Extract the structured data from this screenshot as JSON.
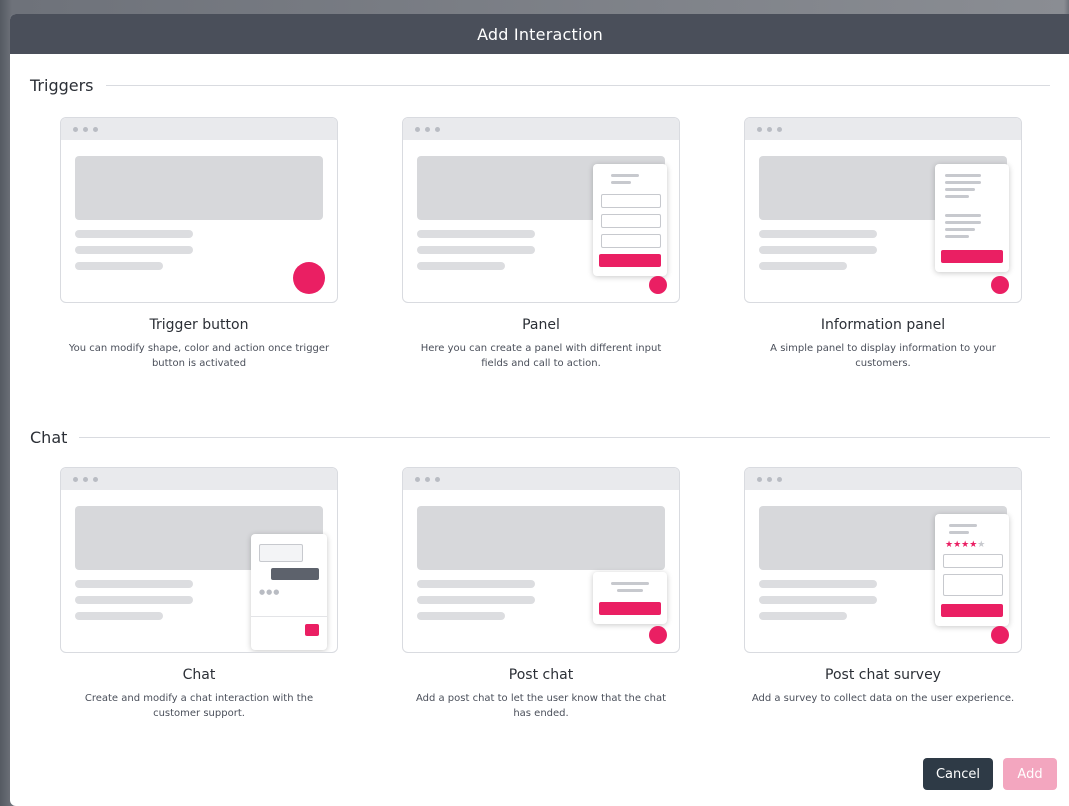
{
  "modal": {
    "title": "Add Interaction"
  },
  "sections": {
    "triggers": {
      "title": "Triggers"
    },
    "chat": {
      "title": "Chat"
    }
  },
  "cards": {
    "trigger_button": {
      "title": "Trigger button",
      "description": "You can modify shape, color and action once trigger button is activated"
    },
    "panel": {
      "title": "Panel",
      "description": "Here you can create a panel with different input fields and call to action."
    },
    "information_panel": {
      "title": "Information panel",
      "description": "A simple panel to display information to your customers."
    },
    "chat": {
      "title": "Chat",
      "description": "Create and modify a chat interaction with the customer support."
    },
    "post_chat": {
      "title": "Post chat",
      "description": "Add a post chat to let the user know that the chat has ended."
    },
    "post_chat_survey": {
      "title": "Post chat survey",
      "description": "Add a survey to collect data on the user experience.",
      "rating_stars": 4,
      "rating_max": 5
    }
  },
  "footer": {
    "cancel_label": "Cancel",
    "add_label": "Add"
  },
  "colors": {
    "header": "#4a4f5a",
    "accent": "#ea1f63",
    "cancel": "#2e3a46",
    "add_disabled": "#f3a6bf"
  }
}
